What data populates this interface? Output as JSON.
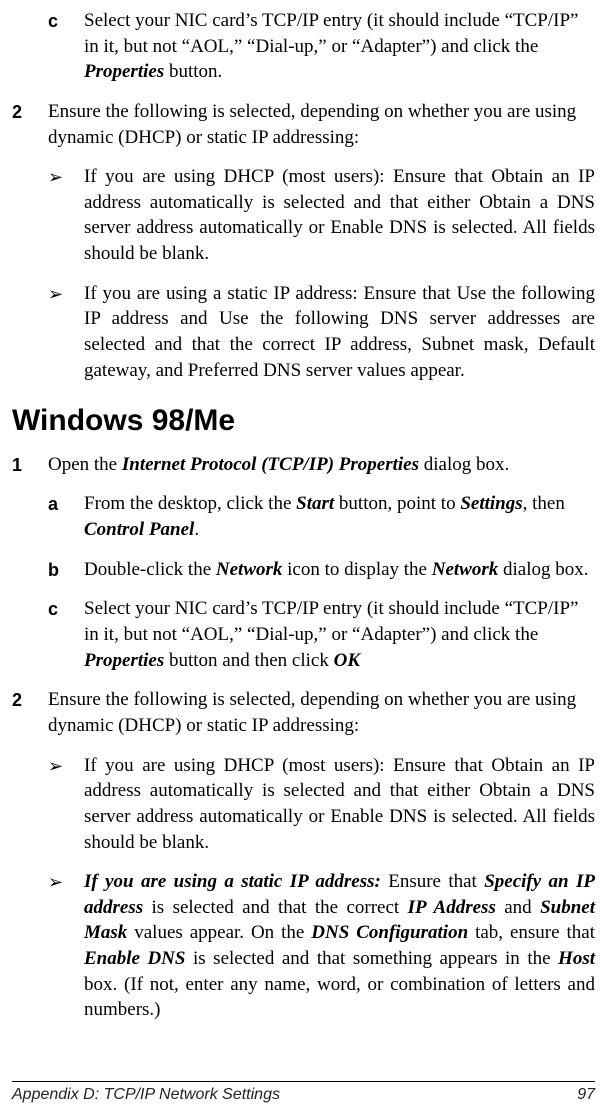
{
  "top": {
    "c_marker": "c",
    "c_body_html": "Select your NIC card’s TCP/IP entry (it should include “TCP/IP” in it, but not “AOL,” “Dial-up,” or “Adapter”) and click the <span class='bi'>Properties</span> button."
  },
  "step2_top": {
    "marker": "2",
    "body": "Ensure the following is selected, depending on whether you are using dynamic (DHCP) or static IP addressing:",
    "bullet1": "If you are using DHCP (most users): Ensure that Obtain an IP address automatically is selected and that either Obtain a DNS server address automatically or Enable DNS is selected. All fields should be blank.",
    "bullet2": "If you are using a static IP address: Ensure that Use the following IP address and Use the following DNS server addresses are selected and that the correct IP address, Subnet mask, Default gateway, and Preferred DNS server values appear."
  },
  "heading": "Windows 98/Me",
  "win": {
    "step1_marker": "1",
    "step1_body_html": "Open the <span class='bi'>Internet Protocol (TCP/IP) Properties</span> dialog box.",
    "a_marker": "a",
    "a_body_html": "From the desktop, click the <span class='bi'>Start</span> button, point to <span class='bi'>Settings</span>, then <span class='bi'>Control Panel</span>.",
    "b_marker": "b",
    "b_body_html": "Double-click the <span class='bi'>Network</span> icon to display the <span class='bi'>Network</span> dialog box.",
    "c_marker": "c",
    "c_body_html": "Select your NIC card’s TCP/IP entry (it should include “TCP/IP” in it, but not “AOL,” “Dial-up,” or “Adapter”) and click the <span class='bi'>Properties</span> button and then click <span class='bi'>OK</span>",
    "step2_marker": "2",
    "step2_body": "Ensure the following is selected, depending on whether you are using dynamic (DHCP) or static IP addressing:",
    "bullet1": "If you are using DHCP (most users): Ensure that Obtain an IP address automatically is selected and that either Obtain a DNS server address automatically or Enable DNS is selected. All fields should be blank.",
    "bullet2_html": "<span class='bi'>If you are using a static IP address:</span> Ensure that <span class='bi'>Specify an IP address</span> is selected and that the correct <span class='bi'>IP Address</span> and <span class='bi'>Subnet Mask</span> values appear. On the <span class='bi'>DNS Configuration</span> tab, ensure that <span class='bi'>Enable DNS</span> is selected and that something appears in the <span class='bi'>Host</span> box. (If not, enter any name, word, or combination of letters and numbers.)"
  },
  "footer": {
    "left": "Appendix D: TCP/IP Network Settings",
    "right": "97"
  },
  "bullet_glyph": "➢"
}
